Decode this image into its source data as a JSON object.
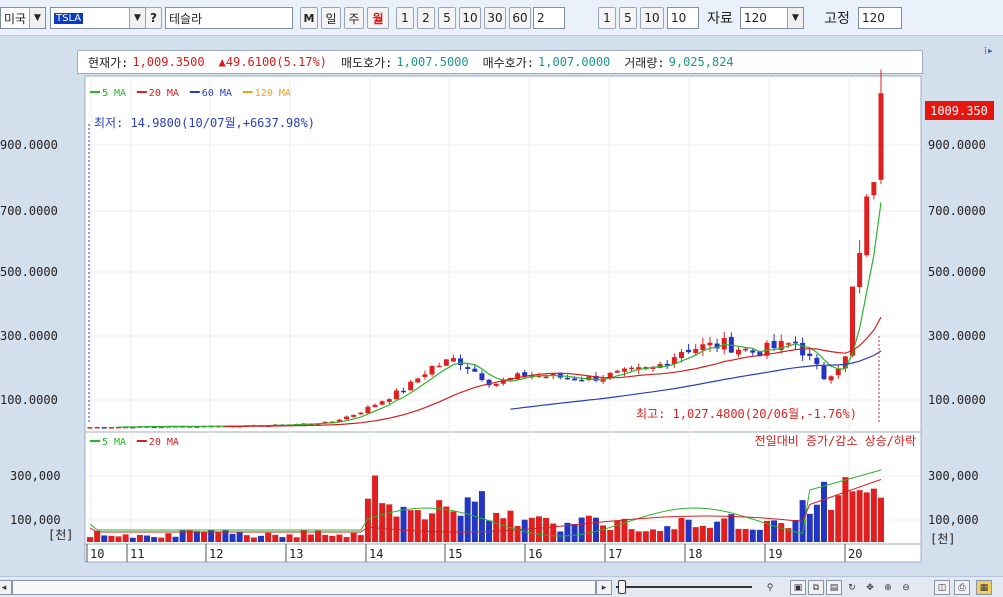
{
  "toolbar": {
    "market": "미국",
    "ticker": "TSLA",
    "help_label": "?",
    "stock_name": "테슬라",
    "minute_label": "M",
    "day_label": "일",
    "week_label": "주",
    "month_label": "월",
    "periods": [
      "1",
      "2",
      "5",
      "10",
      "30",
      "60"
    ],
    "period_value": "2",
    "zoom_buttons": [
      "1",
      "5",
      "10"
    ],
    "zoom_value": "10",
    "data_label": "자료",
    "data_count": "120",
    "fixed_label": "고정",
    "fixed_value": "120"
  },
  "info": {
    "price_label": "현재가:",
    "price": "1,009.3500",
    "change": "▲49.6100(5.17%)",
    "ask_label": "매도호가:",
    "ask": "1,007.5000",
    "bid_label": "매수호가:",
    "bid": "1,007.0000",
    "volume_label": "거래량:",
    "volume": "9,025,824"
  },
  "price_panel": {
    "legend": [
      {
        "label": "5 MA",
        "color": "#2bb52b"
      },
      {
        "label": "20 MA",
        "color": "#d42020"
      },
      {
        "label": "60 MA",
        "color": "#2a3fbf"
      },
      {
        "label": "120 MA",
        "color": "#f0a020"
      }
    ],
    "low_annotation": "최저: 14.9800(10/07월,+6637.98%)",
    "high_annotation": "최고: 1,027.4800(20/06월,-1.76%)",
    "current_tag": "1009.350",
    "y_ticks": [
      "900.0000",
      "700.0000",
      "500.0000",
      "300.0000",
      "100.0000"
    ]
  },
  "volume_panel": {
    "legend": [
      {
        "label": "5 MA",
        "color": "#2bb52b"
      },
      {
        "label": "20 MA",
        "color": "#d42020"
      }
    ],
    "right_caption": "전일대비 증가/감소 상승/하락",
    "y_ticks": [
      "300,000",
      "100,000"
    ],
    "unit": "[천]"
  },
  "x_labels": [
    "10",
    "11",
    "12",
    "13",
    "14",
    "15",
    "16",
    "17",
    "18",
    "19",
    "20"
  ],
  "colors": {
    "up": "#e02020",
    "down": "#2236c0",
    "ma5": "#2bb52b",
    "ma20": "#d42020",
    "ma60": "#2a3fbf",
    "ma120": "#f0a020",
    "tag": "#e8150f"
  }
}
